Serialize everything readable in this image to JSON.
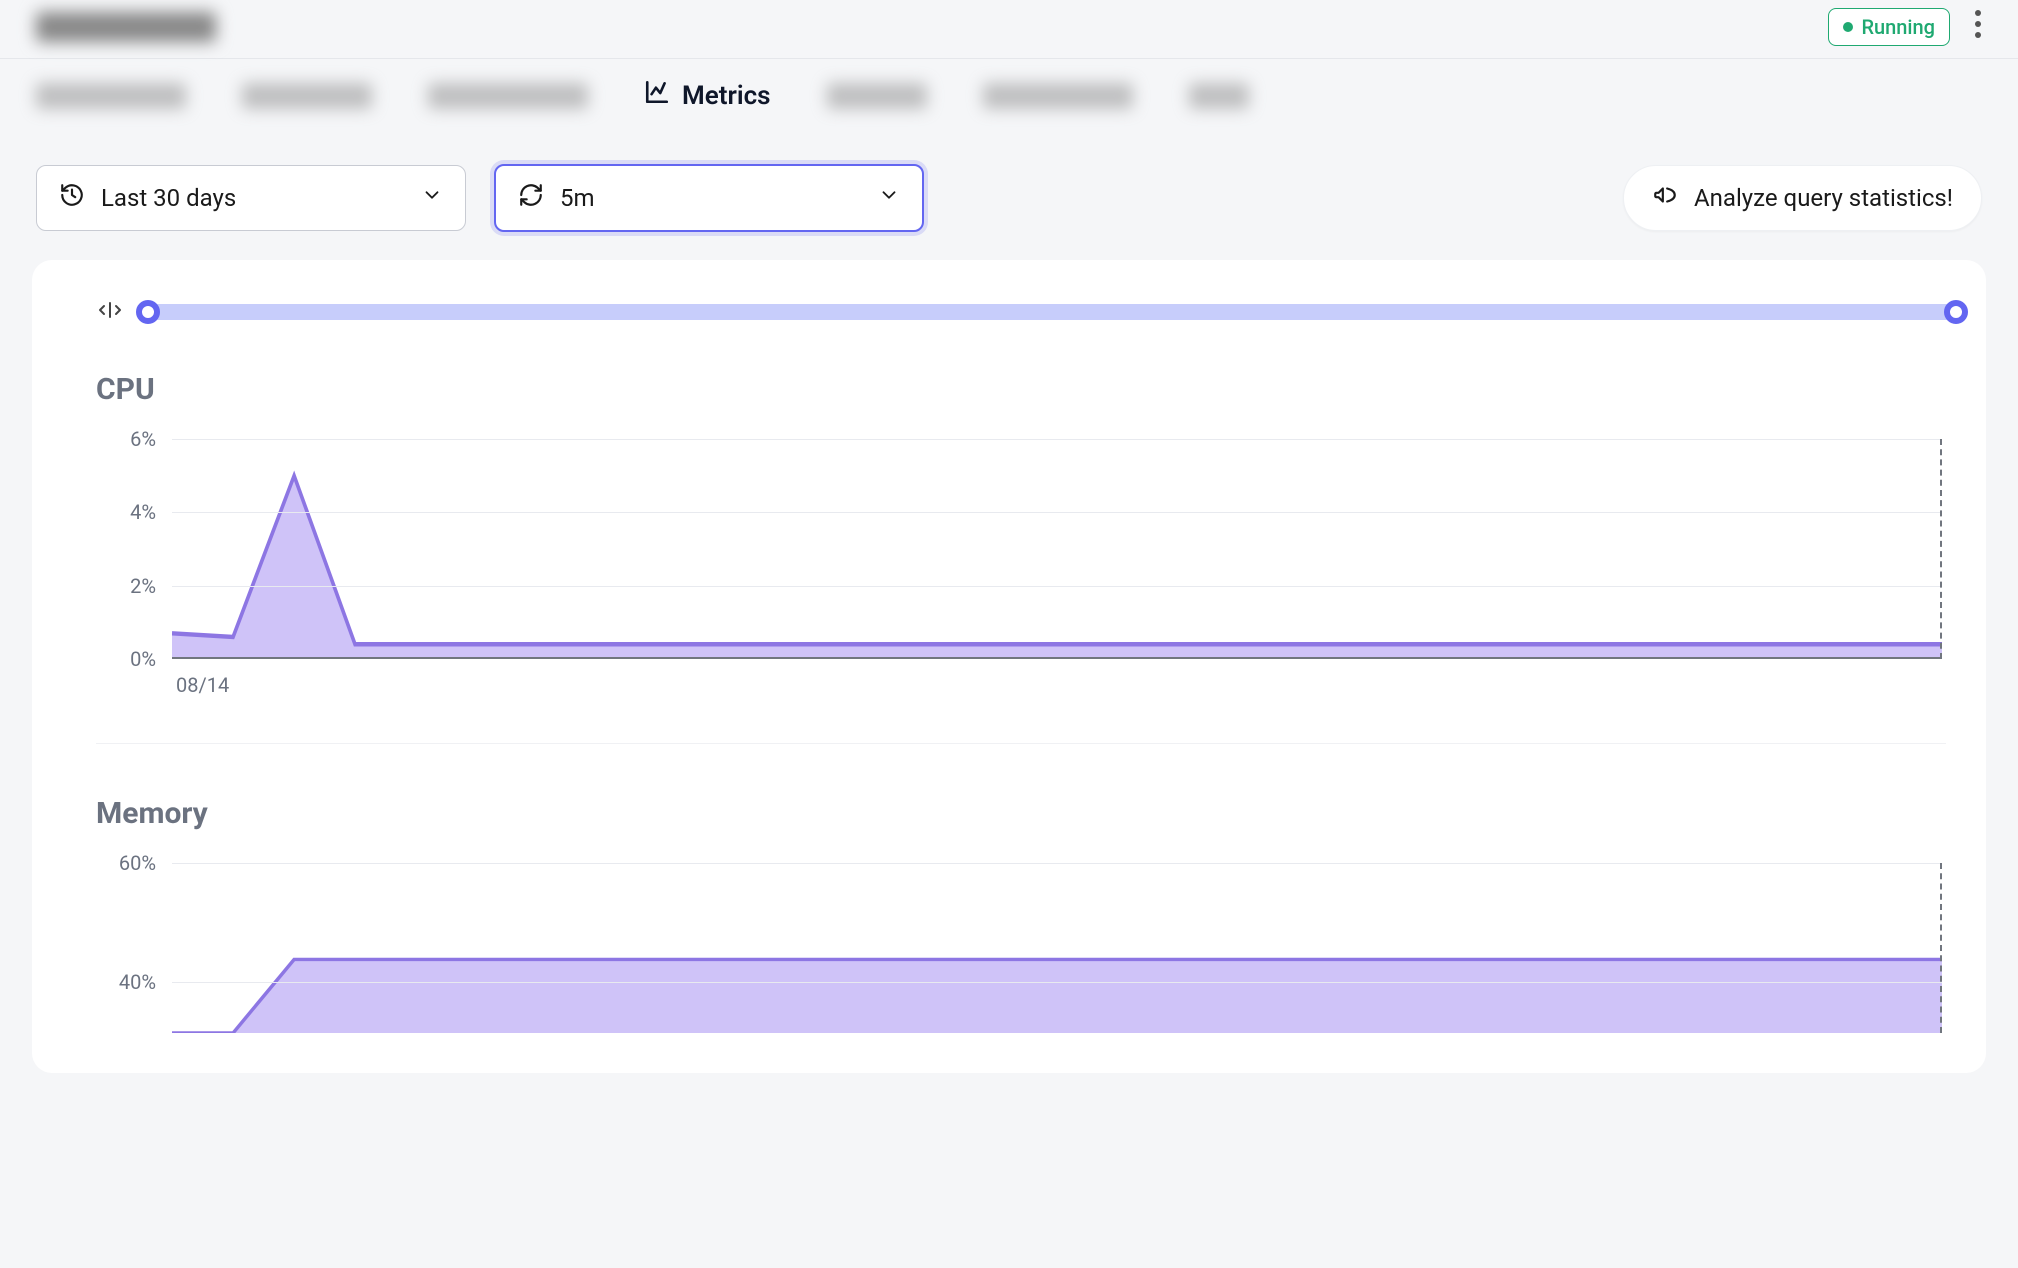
{
  "header": {
    "status_label": "Running"
  },
  "tabs": {
    "active_label": "Metrics"
  },
  "controls": {
    "time_range": "Last 30 days",
    "refresh_interval": "5m",
    "analyze_label": "Analyze query statistics!"
  },
  "charts": {
    "cpu": {
      "title": "CPU",
      "x_label": "08/14",
      "y_ticks": [
        "0%",
        "2%",
        "4%",
        "6%"
      ]
    },
    "memory": {
      "title": "Memory",
      "y_ticks": [
        "40%",
        "60%"
      ]
    }
  },
  "chart_data": [
    {
      "type": "area",
      "title": "CPU",
      "ylabel": "%",
      "ylim": [
        0,
        6
      ],
      "series": [
        {
          "name": "cpu",
          "values": [
            0.7,
            0.6,
            5.0,
            0.4,
            0.4,
            0.4,
            0.4,
            0.4,
            0.4,
            0.4,
            0.4,
            0.4,
            0.4,
            0.4,
            0.4,
            0.4,
            0.4,
            0.4,
            0.4,
            0.4,
            0.4,
            0.4,
            0.4,
            0.4,
            0.4,
            0.4,
            0.4,
            0.4,
            0.4,
            0.4
          ]
        }
      ],
      "x_start_label": "08/14"
    },
    {
      "type": "area",
      "title": "Memory",
      "ylabel": "%",
      "ylim_visible": [
        30,
        60
      ],
      "series": [
        {
          "name": "memory",
          "values": [
            30,
            30,
            43,
            43,
            43,
            43,
            43,
            43,
            43,
            43,
            43,
            43,
            43,
            43,
            43,
            43,
            43,
            43,
            43,
            43,
            43,
            43,
            43,
            43,
            43,
            43,
            43,
            43,
            43,
            43
          ]
        }
      ]
    }
  ]
}
